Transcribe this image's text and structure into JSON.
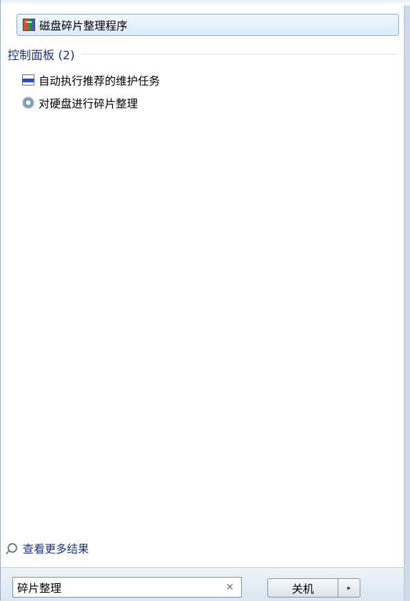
{
  "programs": {
    "items": [
      {
        "label": "磁盘碎片整理程序",
        "icon": "defrag-app-icon"
      }
    ]
  },
  "control_panel": {
    "header": "控制面板 (2)",
    "items": [
      {
        "label": "自动执行推荐的维护任务",
        "icon": "maintenance-task-icon"
      },
      {
        "label": "对硬盘进行碎片整理",
        "icon": "gear-icon"
      }
    ]
  },
  "see_more": {
    "label": "查看更多结果",
    "icon": "search-icon"
  },
  "search": {
    "value": "碎片整理",
    "clear_label": "×"
  },
  "shutdown": {
    "label": "关机",
    "arrow_label": "▸"
  }
}
